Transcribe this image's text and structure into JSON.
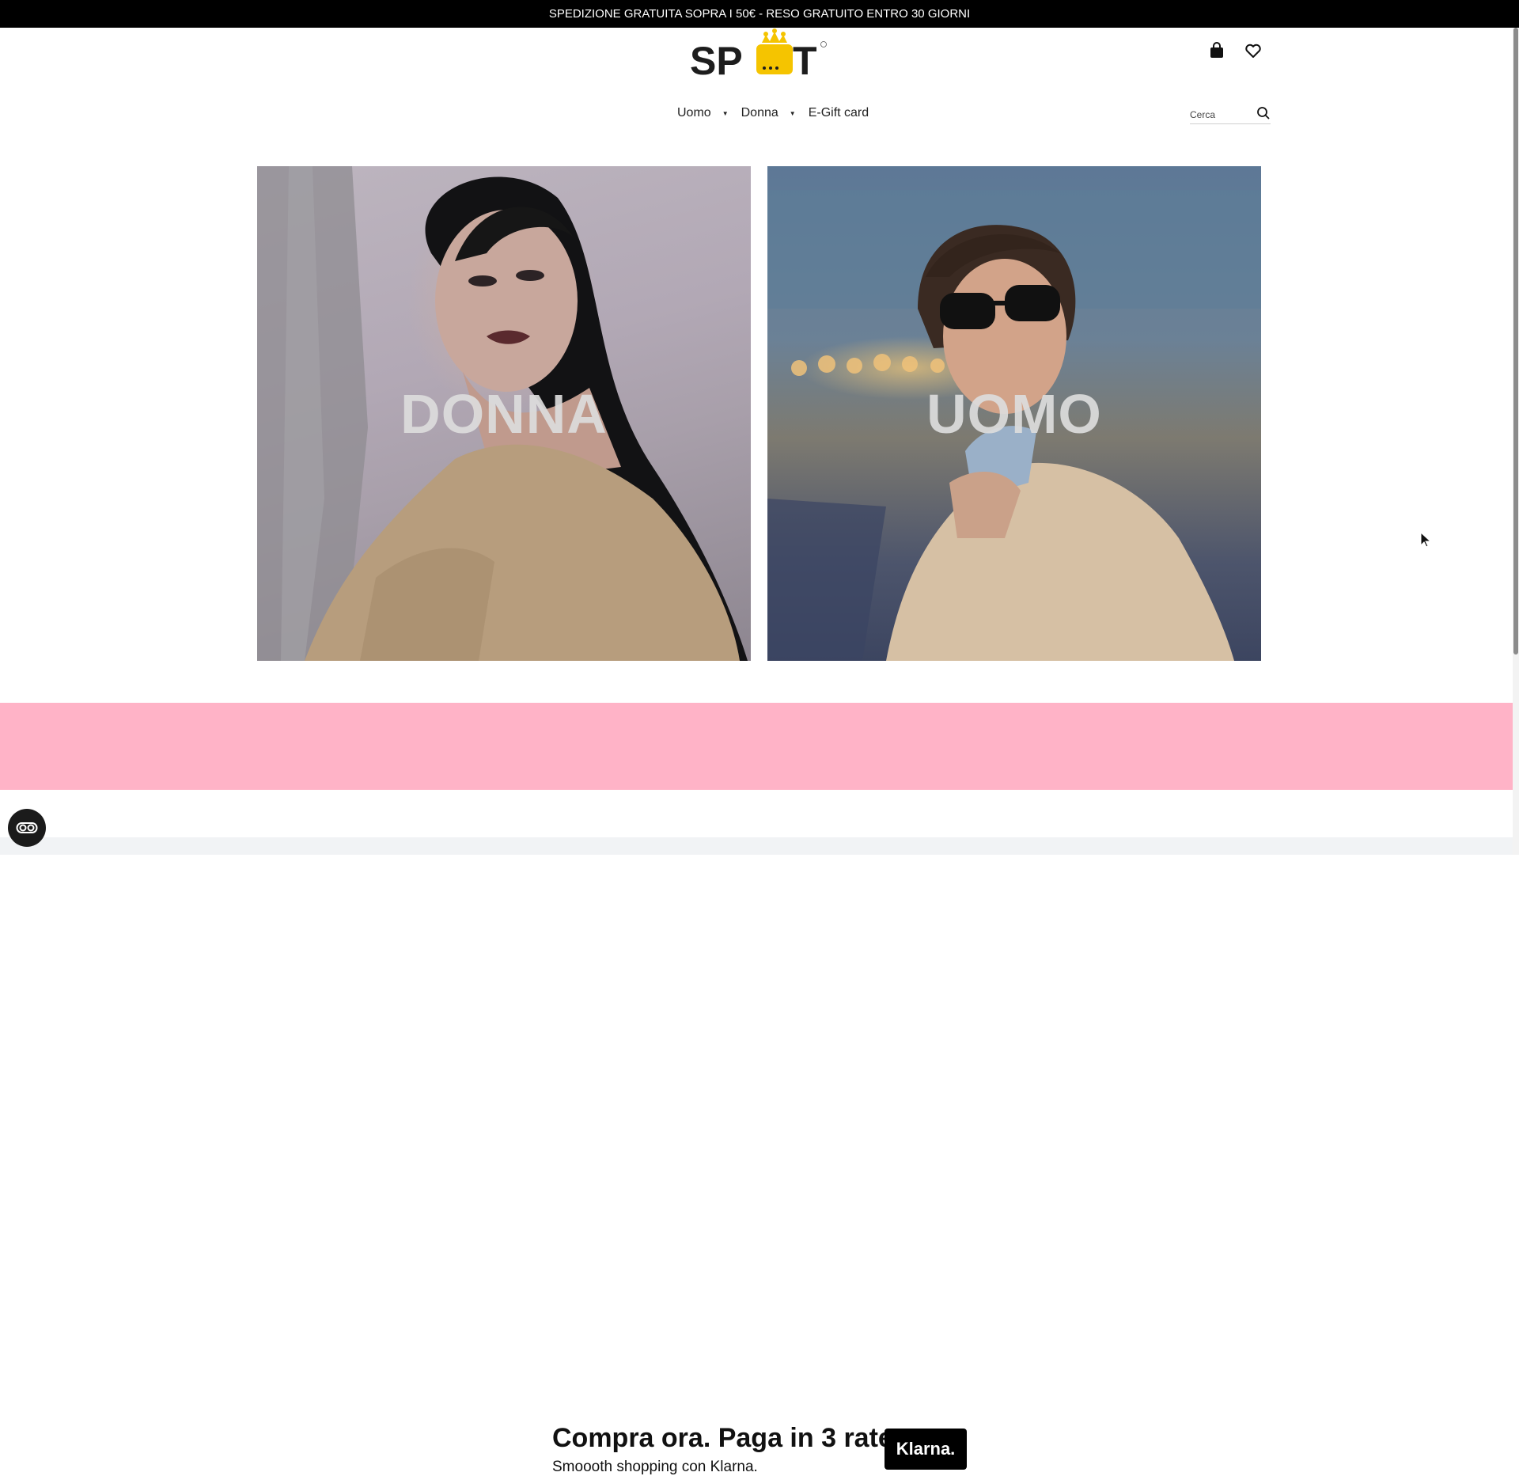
{
  "announcement": "SPEDIZIONE GRATUITA SOPRA I 50€ - RESO GRATUITO ENTRO 30 GIORNI",
  "logo": {
    "text_left": "SP",
    "text_right": "T",
    "accent_color": "#f5c400"
  },
  "header": {
    "cart_icon": "shopping-bag-icon",
    "wishlist_icon": "heart-icon"
  },
  "nav": {
    "items": [
      {
        "label": "Uomo",
        "has_dropdown": true
      },
      {
        "label": "Donna",
        "has_dropdown": true
      },
      {
        "label": "E-Gift card",
        "has_dropdown": false
      }
    ]
  },
  "search": {
    "placeholder": "Cerca",
    "icon": "search-icon"
  },
  "tiles": [
    {
      "label": "DONNA"
    },
    {
      "label": "UOMO"
    }
  ],
  "klarna": {
    "headline": "Compra ora. Paga in 3 rate.",
    "subline": "Smoooth shopping con Klarna.",
    "badge": "Klarna.",
    "background": "#ffb3c7"
  },
  "accessibility_button": {
    "icon": "accessibility-toggle-icon"
  }
}
